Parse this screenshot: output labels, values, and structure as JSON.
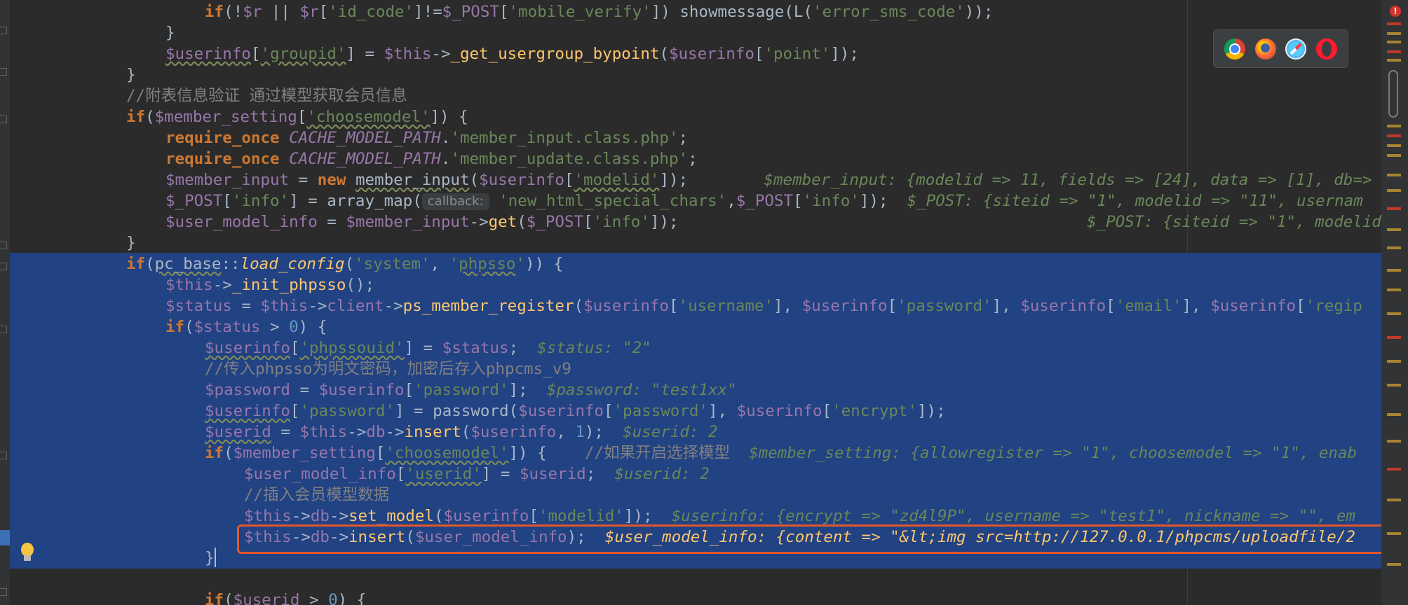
{
  "editor": {
    "param_hint": "callback:",
    "lines": [
      {
        "text": "    if(!$r || $r['id_code']!=$_POST['mobile_verify']) showmessage(L('error_sms_code'));"
      },
      {
        "text": "}"
      },
      {
        "text": "$userinfo['groupid'] = $this->_get_usergroup_bypoint($userinfo['point']);"
      },
      {
        "text": "}"
      },
      {
        "text": "//附表信息验证 通过模型获取会员信息"
      },
      {
        "text": "if($member_setting['choosemodel']) {"
      },
      {
        "text": "require_once CACHE_MODEL_PATH.'member_input.class.php';"
      },
      {
        "text": "require_once CACHE_MODEL_PATH.'member_update.class.php';"
      },
      {
        "text": "$member_input = new member_input($userinfo['modelid']);",
        "hint": "$member_input: {modelid => 11, fields => [24], data => [1], db=>"
      },
      {
        "text": "$_POST['info'] = array_map(",
        "hint": "$_POST: {siteid => \"1\", modelid => \"11\", usernam"
      },
      {
        "text": "$user_model_info = $member_input->get($_POST['info']);",
        "hint": "$_POST: {siteid => \"1\", modelid"
      },
      {
        "text": "}"
      },
      {
        "text": "if(pc_base::load_config('system', 'phpsso')) {"
      },
      {
        "text": "$this->_init_phpsso();"
      },
      {
        "text": "$status = $this->client->ps_member_register($userinfo['username'], $userinfo['password'], $userinfo['email'], $userinfo['regip"
      },
      {
        "text": "if($status > 0) {"
      },
      {
        "text": "$userinfo['phpssouid'] = $status;",
        "hint": "$status: \"2\""
      },
      {
        "text": "//传入phpsso为明文密码，加密后存入phpcms_v9"
      },
      {
        "text": "$password = $userinfo['password'];",
        "hint": "$password: \"test1xx\""
      },
      {
        "text": "$userinfo['password'] = password($userinfo['password'], $userinfo['encrypt']);"
      },
      {
        "text": "$userid = $this->db->insert($userinfo, 1);",
        "hint": "$userid: 2"
      },
      {
        "text": "if($member_setting['choosemodel']) {    //如果开启选择模型",
        "hint": "$member_setting: {allowregister => \"1\", choosemodel => \"1\", enab"
      },
      {
        "text": "$user_model_info['userid'] = $userid;",
        "hint": "$userid: 2"
      },
      {
        "text": "//插入会员模型数据"
      },
      {
        "text": "$this->db->set_model($userinfo['modelid']);",
        "hint": "$userinfo: {encrypt => \"zd4l9P\", username => \"test1\", nickname => \"\", em"
      },
      {
        "text": "$this->db->insert($user_model_info);",
        "hint": "$user_model_info: {content => \"&lt;img src=http://127.0.0.1/phpcms/uploadfile/2"
      },
      {
        "text": "}"
      },
      {
        "text": ""
      },
      {
        "text": "if($userid > 0) {"
      }
    ]
  },
  "colors": {
    "background": "#2b2b2b",
    "selection": "#214283",
    "keyword": "#cc7832",
    "variable": "#9876aa",
    "string": "#6a8759",
    "function": "#ffc66d",
    "comment": "#808080",
    "breakpoint_box": "#e2572b"
  },
  "browsers": [
    "chrome-icon",
    "firefox-icon",
    "safari-icon",
    "opera-icon"
  ],
  "scrollbar": {
    "error_label": "!"
  }
}
